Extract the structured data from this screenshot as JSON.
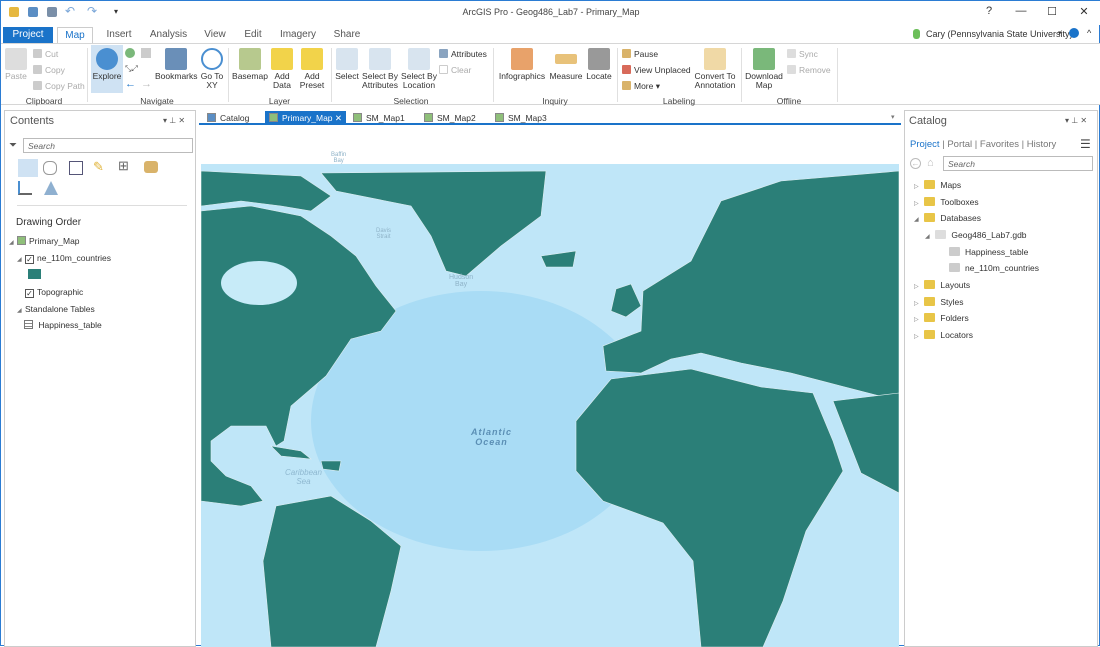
{
  "window": {
    "title": "ArcGIS Pro - Geog486_Lab7 - Primary_Map",
    "help": "?",
    "minimize": "—",
    "maximize": "☐",
    "close": "✕"
  },
  "quick_access": {
    "undo": "↶",
    "redo": "↷",
    "customize": "▾"
  },
  "user": {
    "name": "Cary (Pennsylvania State University)",
    "dropdown": "▾",
    "notif": "🔔",
    "collapse": "^"
  },
  "ribbon_tabs": [
    "Project",
    "Map",
    "Insert",
    "Analysis",
    "View",
    "Edit",
    "Imagery",
    "Share"
  ],
  "active_tab": "Map",
  "ribbon": {
    "clipboard": {
      "label": "Clipboard",
      "paste": "Paste",
      "cut": "Cut",
      "copy": "Copy",
      "copy_path": "Copy Path"
    },
    "navigate": {
      "label": "Navigate",
      "explore": "Explore",
      "bookmarks": "Bookmarks",
      "go_to_xy": "Go To XY"
    },
    "layer": {
      "label": "Layer",
      "basemap": "Basemap",
      "add_data": "Add Data",
      "add_preset": "Add Preset"
    },
    "selection": {
      "label": "Selection",
      "select": "Select",
      "select_by_attributes": "Select By Attributes",
      "select_by_location": "Select By Location",
      "attributes": "Attributes",
      "clear": "Clear"
    },
    "inquiry": {
      "label": "Inquiry",
      "infographics": "Infographics",
      "measure": "Measure",
      "locate": "Locate"
    },
    "labeling": {
      "label": "Labeling",
      "pause": "Pause",
      "view_unplaced": "View Unplaced",
      "more": "More",
      "convert": "Convert To Annotation"
    },
    "offline": {
      "label": "Offline",
      "download_map": "Download Map",
      "sync": "Sync",
      "remove": "Remove"
    }
  },
  "contents": {
    "title": "Contents",
    "search_placeholder": "Search",
    "heading": "Drawing Order",
    "map": "Primary_Map",
    "layers": [
      {
        "name": "ne_110m_countries",
        "checked": true,
        "symbol_color": "#2b7f78"
      },
      {
        "name": "Topographic",
        "checked": true
      }
    ],
    "standalone": "Standalone Tables",
    "tables": [
      "Happiness_table"
    ]
  },
  "doc_tabs": [
    "Catalog",
    "Primary_Map",
    "SM_Map1",
    "SM_Map2",
    "SM_Map3"
  ],
  "active_doc": "Primary_Map",
  "map": {
    "land_color": "#2b7f78",
    "ocean_color": "#bfe6f8",
    "labels": {
      "atlantic": "Atlantic",
      "ocean": "Ocean",
      "caribbean": "Caribbean",
      "sea": "Sea",
      "hudson": "Hudson",
      "bay": "Bay",
      "baffin": "Baffin",
      "baffin_bay": "Bay",
      "davis": "Davis",
      "strait": "Strait"
    }
  },
  "catalog": {
    "title": "Catalog",
    "tabs": [
      "Project",
      "Portal",
      "Favorites",
      "History"
    ],
    "search_placeholder": "Search",
    "items": [
      "Maps",
      "Toolboxes",
      "Databases",
      "Geog486_Lab7.gdb",
      "Happiness_table",
      "ne_110m_countries",
      "Layouts",
      "Styles",
      "Folders",
      "Locators"
    ]
  }
}
